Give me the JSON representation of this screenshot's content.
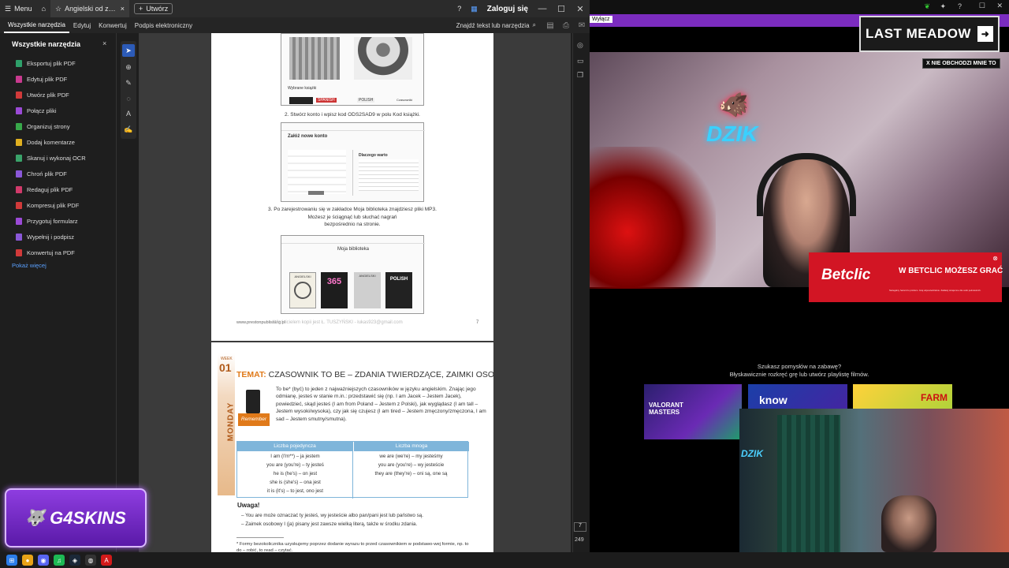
{
  "acrobat": {
    "titlebar": {
      "menu_label": "Menu",
      "tab_title": "Angielski od zera w ...",
      "create_label": "Utwórz",
      "signin_label": "Zaloguj się"
    },
    "menubar": {
      "items": [
        "Wszystkie narzędzia",
        "Edytuj",
        "Konwertuj",
        "Podpis elektroniczny"
      ],
      "find_label": "Znajdź tekst lub narzędzia"
    },
    "tools_panel": {
      "title": "Wszystkie narzędzia",
      "items": [
        {
          "label": "Eksportuj plik PDF",
          "color": "#2ea06a"
        },
        {
          "label": "Edytuj plik PDF",
          "color": "#c93a8f"
        },
        {
          "label": "Utwórz plik PDF",
          "color": "#d13a3a"
        },
        {
          "label": "Połącz pliki",
          "color": "#9b4ad6"
        },
        {
          "label": "Organizuj strony",
          "color": "#38a84a"
        },
        {
          "label": "Dodaj komentarze",
          "color": "#e0b020"
        },
        {
          "label": "Skanuj i wykonaj OCR",
          "color": "#3aa36a"
        },
        {
          "label": "Chroń plik PDF",
          "color": "#8a58d8"
        },
        {
          "label": "Redaguj plik PDF",
          "color": "#d13a6a"
        },
        {
          "label": "Kompresuj plik PDF",
          "color": "#d13a3a"
        },
        {
          "label": "Przygotuj formularz",
          "color": "#9b4ad6"
        },
        {
          "label": "Wypełnij i podpisz",
          "color": "#8a58d8"
        },
        {
          "label": "Konwertuj na PDF",
          "color": "#d13a3a"
        }
      ],
      "show_more": "Pokaż więcej"
    },
    "page_nav": {
      "current": "7",
      "total": "249"
    },
    "page1": {
      "step2": "2. Stwórz konto i wpisz kod ODS2SAD9 w polu Kod książki.",
      "step3_line1": "3. Po zarejestrowaniu się w zakładce Moja biblioteka znajdziesz pliki MP3.",
      "step3_line2": "Możesz je ściągnąć lub słuchać nagrań",
      "step3_line3": "bezpośrednio na stronie.",
      "shot1_label": "Wybrane książki",
      "shot1_tags": [
        "SPANISH",
        "POLISH",
        "Czasowniki"
      ],
      "shot2_title": "Załóż nowe konto",
      "shot2_side": "Dlaczego warto",
      "shot3_title": "Moja biblioteka",
      "cover_labels": [
        "ANGIELSKI",
        "365",
        "ANGIELSKI",
        "POLISH"
      ],
      "footer_url": "www.prestonpublishing.pl",
      "watermark": "Właścicielem kopii jest Ł. TUSZYŃSKI - łukas923@gmail.com",
      "page_number": "7"
    },
    "page2": {
      "week_label": "WEEK",
      "week_num": "01",
      "day": "MONDAY",
      "head_tm": "TEMAT:",
      "head_rest": "CZASOWNIK TO BE – ZDANIA TWIERDZĄCE, ZAIMKI OSOBOWE",
      "remember": "Remember",
      "intro": "To be* (być) to jeden z najważniejszych czasowników w języku angielskim. Znając jego odmianę, jesteś w stanie m.in.: przedstawić się (np. I am Jacek – Jestem Jacek), powiedzieć, skąd jesteś (I am from Poland – Jestem z Polski), jak wyglądasz (I am tall – Jestem wysoki/wysoka), czy jak się czujesz (I am tired – Jestem zmęczony/zmęczona, I am sad – Jestem smutny/smutna).",
      "table_headers": [
        "Liczba pojedyncza",
        "Liczba mnoga"
      ],
      "singular": [
        "I am (I'm**) – ja jestem",
        "you are (you're) – ty jesteś",
        "he is (he's) – on jest",
        "she is (she's) – ona jest",
        "it is (it's) – to jest, ono jest"
      ],
      "plural": [
        "we are (we're) – my jesteśmy",
        "you are (you're) – wy jesteście",
        "they are (they're) – oni są, one są"
      ],
      "note_title": "Uwaga!",
      "notes": [
        "You are może oznaczać ty jesteś, wy jesteście albo pan/pani jest lub państwo są.",
        "Zaimek osobowy I (ja) pisany jest zawsze wielką literą, także w środku zdania."
      ],
      "footnote": "* Formy bezokolicznika uzyskujemy poprzez dodanie wyrazu to przed czasownikiem w podstawo-wej formie, np. to do – robić, to read – czytać."
    }
  },
  "stream": {
    "purple_label": "Wyłącz",
    "last_meadow": "LAST MEADOW",
    "ignore_tag": "X NIE OBCHODZI MNIE TO",
    "neon": "DZIK",
    "betclic_logo": "Betclic",
    "betclic_msg": "W BETCLIC MOŻESZ GRAĆ",
    "betclic_fine": "Nielegalny hazard to problem. Graj odpowiedzialnie. Zakłady wzajemne dla osób pełnoletnich.",
    "suggest_line1": "Szukasz pomysłów na zabawę?",
    "suggest_line2": "Błyskawicznie rozkręć grę lub utwórz playlistę filmów.",
    "thumbs": [
      {
        "label": "VALORANT MASTERS",
        "color": "#3a2a7a"
      },
      {
        "label": "know",
        "color": "#1b3fa8"
      },
      {
        "label": "FARM",
        "color": "#c8d23a"
      }
    ],
    "dzik2": "DZIK"
  },
  "overlay": {
    "skins_label": "G4SKINS"
  }
}
